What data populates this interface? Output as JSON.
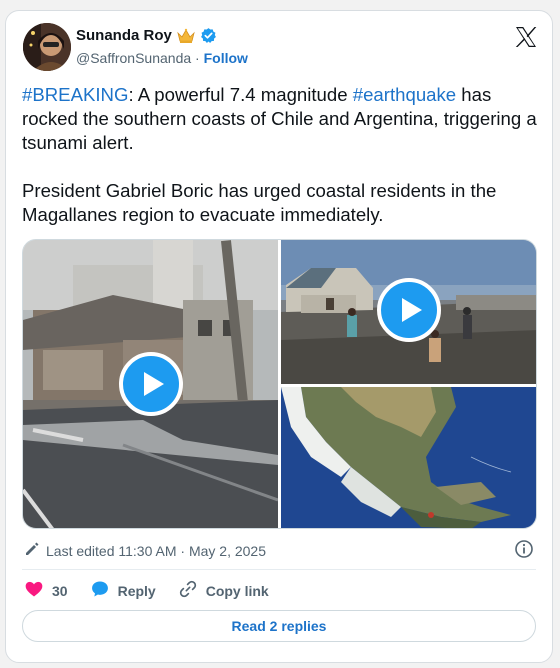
{
  "author": {
    "name": "Sunanda Roy",
    "handle": "@SaffronSunanda",
    "separator": "·",
    "follow_label": "Follow"
  },
  "tweet": {
    "hashtag_breaking": "#BREAKING",
    "part1": ": A powerful 7.4 magnitude ",
    "hashtag_earthquake": "#earthquake",
    "part2": " has rocked the southern coasts of Chile and Argentina, triggering a tsunami alert.",
    "paragraph2": "President Gabriel Boric has urged coastal residents in the Magallanes region to evacuate immediately."
  },
  "meta": {
    "edited_text": "Last edited 11:30 AM · May 2, 2025"
  },
  "actions": {
    "like_count": "30",
    "reply_label": "Reply",
    "copy_label": "Copy link"
  },
  "read_replies_label": "Read 2 replies",
  "colors": {
    "accent": "#1d9bf0",
    "link": "#1d73c9",
    "like": "#f91880"
  },
  "icons": [
    "crown-emoji-icon",
    "verified-badge-icon",
    "x-logo-icon",
    "play-icon",
    "pencil-icon",
    "info-icon",
    "heart-icon",
    "reply-bubble-icon",
    "link-icon"
  ]
}
